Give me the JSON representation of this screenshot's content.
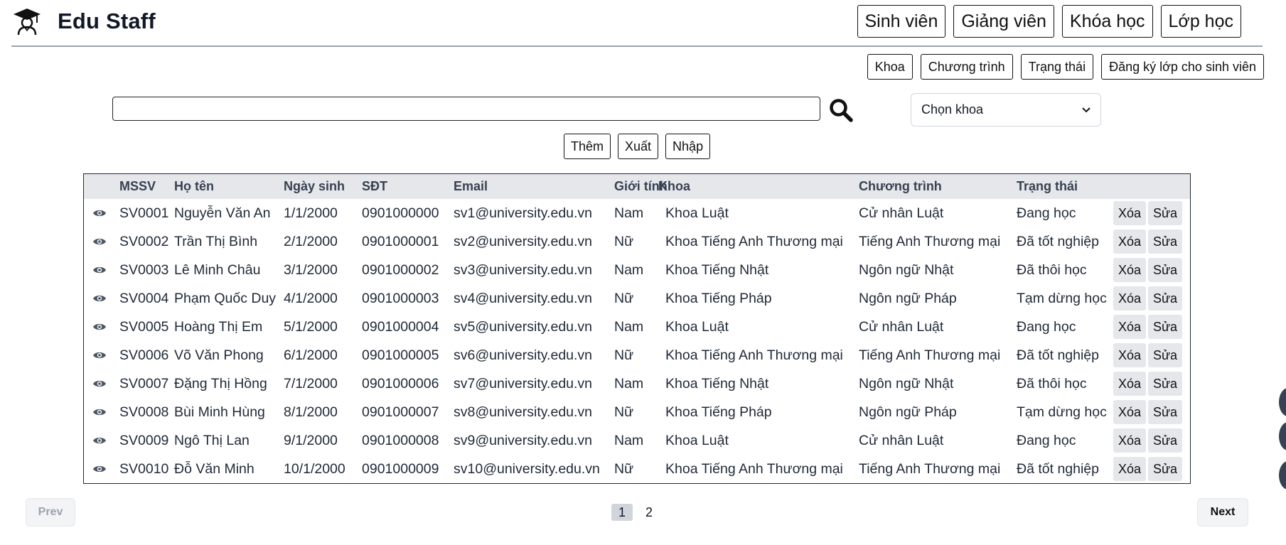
{
  "header": {
    "brand": "Edu Staff",
    "logo_icon": "graduation-cap-icon",
    "nav": [
      "Sinh viên",
      "Giảng viên",
      "Khóa học",
      "Lớp học"
    ]
  },
  "subnav": [
    "Khoa",
    "Chương trình",
    "Trạng thái",
    "Đăng ký lớp cho sinh viên"
  ],
  "search": {
    "value": "",
    "placeholder": "",
    "icon": "search-icon"
  },
  "faculty_select": {
    "selected": "Chọn khoa"
  },
  "actions": {
    "add": "Thêm",
    "export": "Xuất",
    "import": "Nhập"
  },
  "table": {
    "columns": [
      "",
      "MSSV",
      "Họ tên",
      "Ngày sinh",
      "SĐT",
      "Email",
      "Giới tính",
      "Khoa",
      "Chương trình",
      "Trạng thái",
      "",
      ""
    ],
    "rows": [
      {
        "id": "SV0001",
        "name": "Nguyễn Văn An",
        "dob": "1/1/2000",
        "phone": "0901000000",
        "email": "sv1@university.edu.vn",
        "gender": "Nam",
        "faculty": "Khoa Luật",
        "program": "Cử nhân Luật",
        "status": "Đang học"
      },
      {
        "id": "SV0002",
        "name": "Trần Thị Bình",
        "dob": "2/1/2000",
        "phone": "0901000001",
        "email": "sv2@university.edu.vn",
        "gender": "Nữ",
        "faculty": "Khoa Tiếng Anh Thương mại",
        "program": "Tiếng Anh Thương mại",
        "status": "Đã tốt nghiệp"
      },
      {
        "id": "SV0003",
        "name": "Lê Minh Châu",
        "dob": "3/1/2000",
        "phone": "0901000002",
        "email": "sv3@university.edu.vn",
        "gender": "Nam",
        "faculty": "Khoa Tiếng Nhật",
        "program": "Ngôn ngữ Nhật",
        "status": "Đã thôi học"
      },
      {
        "id": "SV0004",
        "name": "Phạm Quốc Duy",
        "dob": "4/1/2000",
        "phone": "0901000003",
        "email": "sv4@university.edu.vn",
        "gender": "Nữ",
        "faculty": "Khoa Tiếng Pháp",
        "program": "Ngôn ngữ Pháp",
        "status": "Tạm dừng học"
      },
      {
        "id": "SV0005",
        "name": "Hoàng Thị Em",
        "dob": "5/1/2000",
        "phone": "0901000004",
        "email": "sv5@university.edu.vn",
        "gender": "Nam",
        "faculty": "Khoa Luật",
        "program": "Cử nhân Luật",
        "status": "Đang học"
      },
      {
        "id": "SV0006",
        "name": "Võ Văn Phong",
        "dob": "6/1/2000",
        "phone": "0901000005",
        "email": "sv6@university.edu.vn",
        "gender": "Nữ",
        "faculty": "Khoa Tiếng Anh Thương mại",
        "program": "Tiếng Anh Thương mại",
        "status": "Đã tốt nghiệp"
      },
      {
        "id": "SV0007",
        "name": "Đặng Thị Hồng",
        "dob": "7/1/2000",
        "phone": "0901000006",
        "email": "sv7@university.edu.vn",
        "gender": "Nam",
        "faculty": "Khoa Tiếng Nhật",
        "program": "Ngôn ngữ Nhật",
        "status": "Đã thôi học"
      },
      {
        "id": "SV0008",
        "name": "Bùi Minh Hùng",
        "dob": "8/1/2000",
        "phone": "0901000007",
        "email": "sv8@university.edu.vn",
        "gender": "Nữ",
        "faculty": "Khoa Tiếng Pháp",
        "program": "Ngôn ngữ Pháp",
        "status": "Tạm dừng học"
      },
      {
        "id": "SV0009",
        "name": "Ngô Thị Lan",
        "dob": "9/1/2000",
        "phone": "0901000008",
        "email": "sv9@university.edu.vn",
        "gender": "Nam",
        "faculty": "Khoa Luật",
        "program": "Cử nhân Luật",
        "status": "Đang học"
      },
      {
        "id": "SV0010",
        "name": "Đỗ Văn Minh",
        "dob": "10/1/2000",
        "phone": "0901000009",
        "email": "sv10@university.edu.vn",
        "gender": "Nữ",
        "faculty": "Khoa Tiếng Anh Thương mại",
        "program": "Tiếng Anh Thương mại",
        "status": "Đã tốt nghiệp"
      }
    ],
    "row_delete_label": "Xóa",
    "row_edit_label": "Sửa",
    "row_view_icon": "eye-icon"
  },
  "pagination": {
    "prev": "Prev",
    "next": "Next",
    "pages": [
      "1",
      "2"
    ],
    "current": "1"
  },
  "colors": {
    "header_bg": "#e5e7eb",
    "row_button_bg": "#e5e7eb",
    "border": "#1f2937"
  }
}
